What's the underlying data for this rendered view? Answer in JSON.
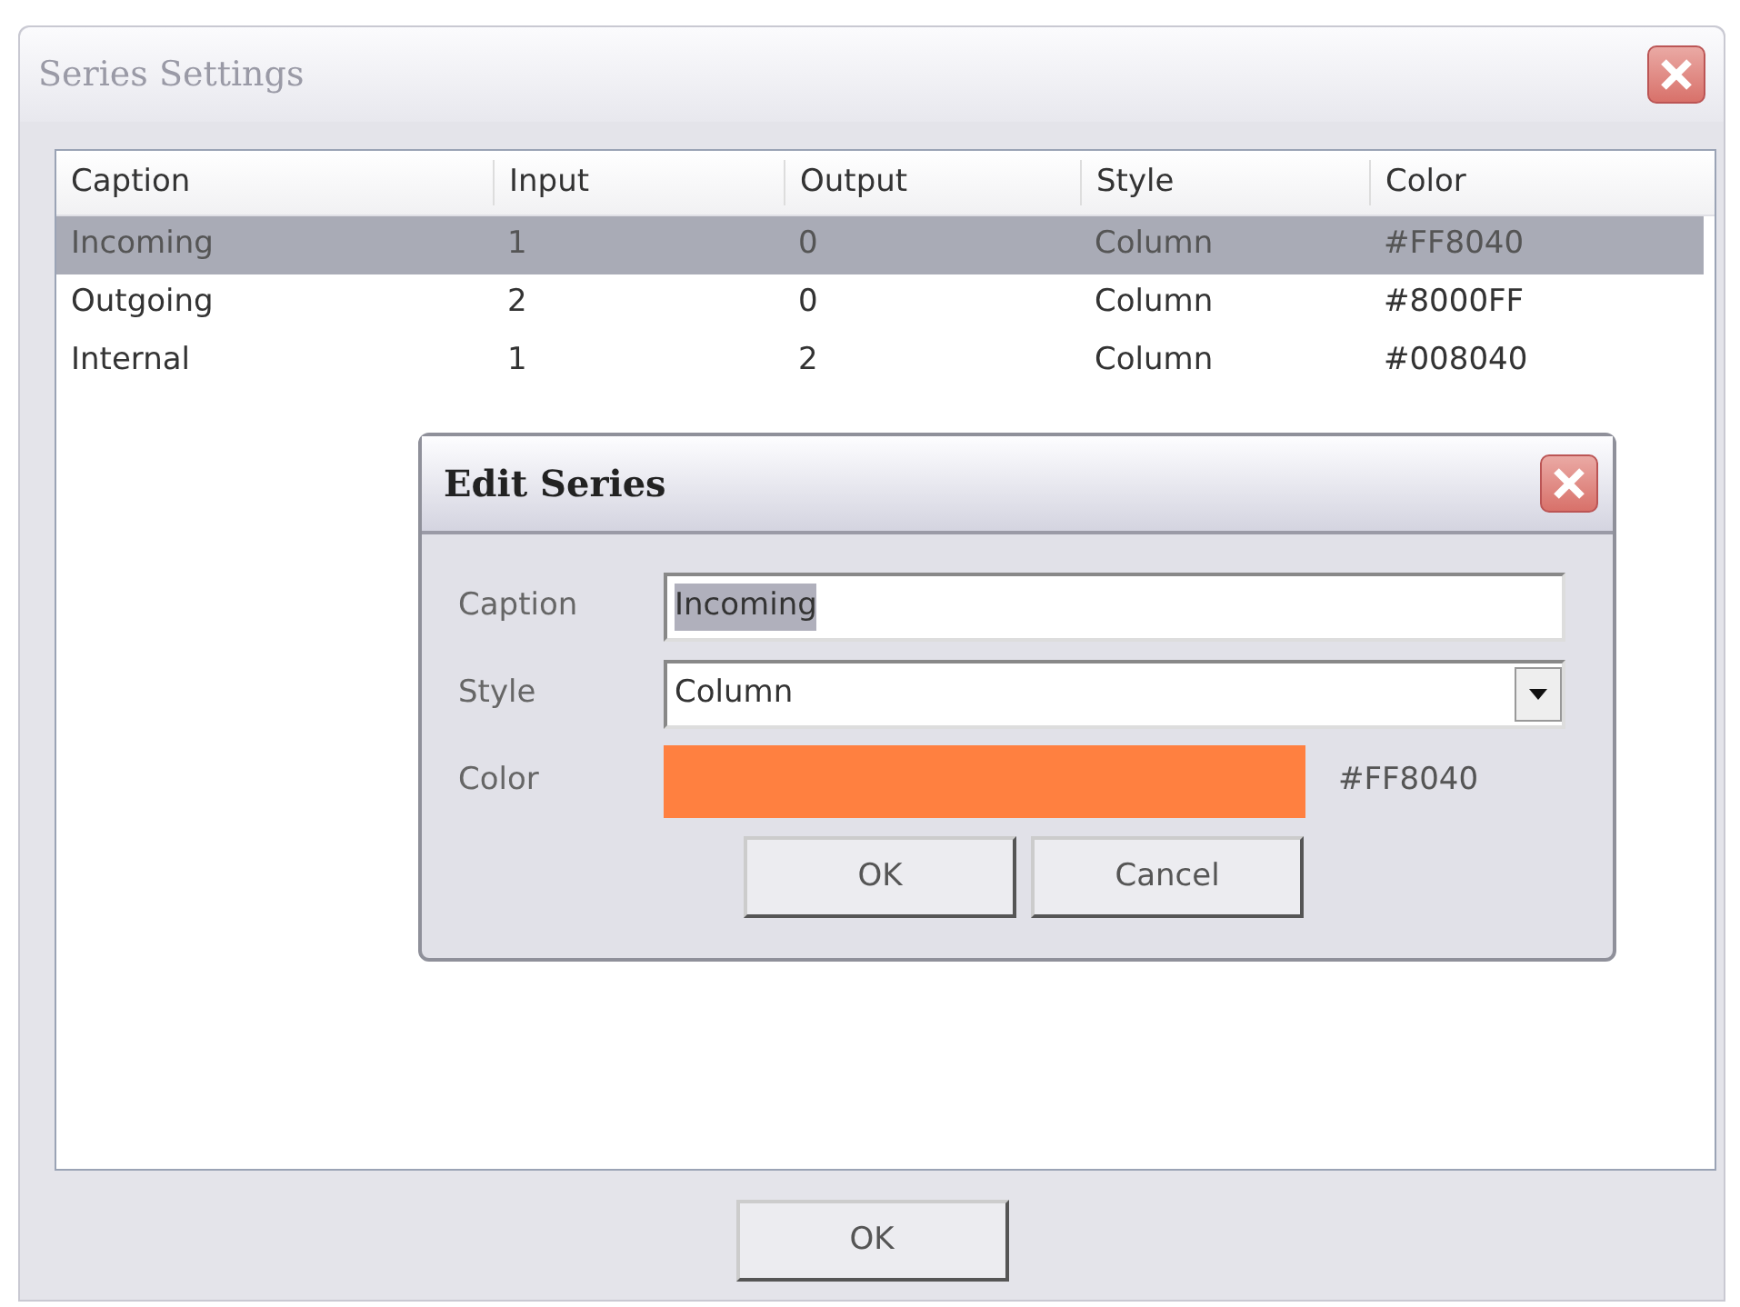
{
  "window": {
    "title": "Series Settings"
  },
  "table": {
    "columns": [
      "Caption",
      "Input",
      "Output",
      "Style",
      "Color"
    ],
    "rows": [
      {
        "cells": [
          "Incoming",
          "1",
          "0",
          "Column",
          "#FF8040"
        ],
        "selected": true
      },
      {
        "cells": [
          "Outgoing",
          "2",
          "0",
          "Column",
          "#8000FF"
        ],
        "selected": false
      },
      {
        "cells": [
          "Internal",
          "1",
          "2",
          "Column",
          "#008040"
        ],
        "selected": false
      }
    ]
  },
  "dialog": {
    "title": "Edit Series",
    "fields": [
      {
        "kind": "text",
        "label": "Caption",
        "value": "Incoming",
        "text_selected": true
      },
      {
        "kind": "select",
        "label": "Style",
        "value": "Column"
      },
      {
        "kind": "color",
        "label": "Color",
        "color": "#ff8040",
        "value": "#FF8040"
      }
    ],
    "buttons": [
      "OK",
      "Cancel"
    ]
  },
  "buttons": [
    "OK"
  ]
}
